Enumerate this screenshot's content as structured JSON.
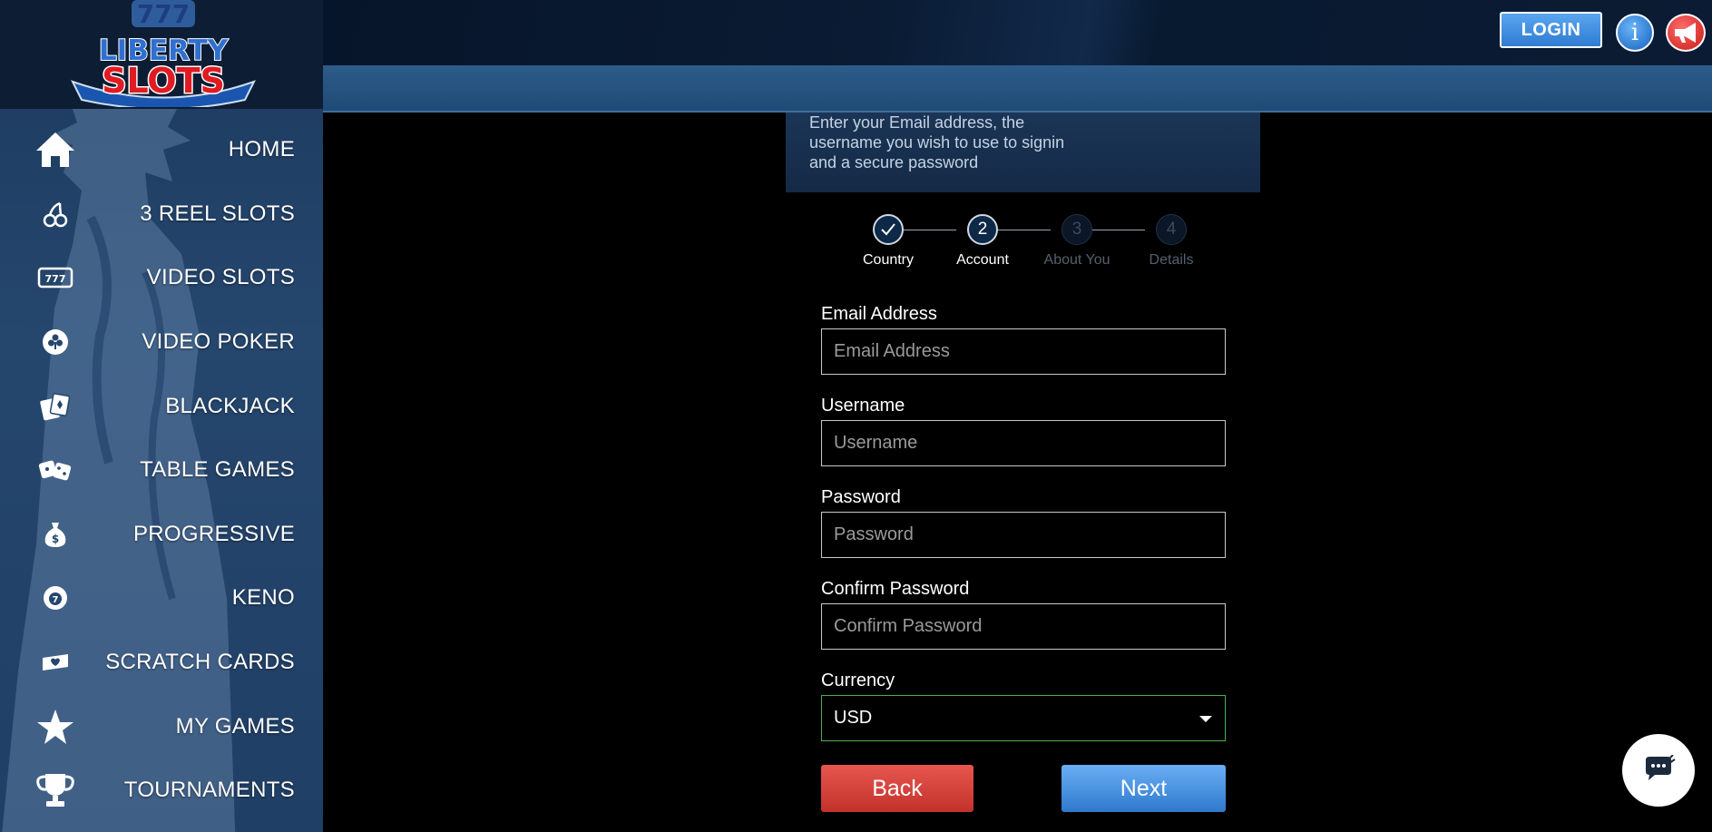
{
  "brand": {
    "logo_line1": "LIBERTY",
    "logo_line2": "SLOTS",
    "logo_sevens": "777"
  },
  "sidebar": {
    "items": [
      {
        "label": "HOME",
        "icon": "home-icon"
      },
      {
        "label": "3 REEL SLOTS",
        "icon": "cherries-icon"
      },
      {
        "label": "VIDEO SLOTS",
        "icon": "slot-machine-icon"
      },
      {
        "label": "VIDEO POKER",
        "icon": "club-chip-icon"
      },
      {
        "label": "BLACKJACK",
        "icon": "cards-icon"
      },
      {
        "label": "TABLE GAMES",
        "icon": "dice-icon"
      },
      {
        "label": "PROGRESSIVE",
        "icon": "money-bag-icon"
      },
      {
        "label": "KENO",
        "icon": "keno-ball-icon"
      },
      {
        "label": "SCRATCH CARDS",
        "icon": "scratch-card-icon"
      },
      {
        "label": "MY GAMES",
        "icon": "star-icon"
      },
      {
        "label": "TOURNAMENTS",
        "icon": "trophy-icon"
      }
    ]
  },
  "header": {
    "login_label": "LOGIN",
    "info_label": "i"
  },
  "instructions": {
    "line1": "Enter your Email address, the",
    "line2": "username you wish to use to signin",
    "line3": "and a secure password"
  },
  "stepper": {
    "steps": [
      {
        "number": "",
        "label": "Country",
        "state": "done"
      },
      {
        "number": "2",
        "label": "Account",
        "state": "active"
      },
      {
        "number": "3",
        "label": "About You",
        "state": "todo"
      },
      {
        "number": "4",
        "label": "Details",
        "state": "todo"
      }
    ]
  },
  "form": {
    "email": {
      "label": "Email Address",
      "placeholder": "Email Address",
      "value": ""
    },
    "username": {
      "label": "Username",
      "placeholder": "Username",
      "value": ""
    },
    "password": {
      "label": "Password",
      "placeholder": "Password",
      "value": ""
    },
    "confirm_password": {
      "label": "Confirm Password",
      "placeholder": "Confirm Password",
      "value": ""
    },
    "currency": {
      "label": "Currency",
      "selected": "USD"
    }
  },
  "actions": {
    "back_label": "Back",
    "next_label": "Next"
  },
  "colors": {
    "sidebar_bg": "#25466d",
    "login_blue": "#2f7bd1",
    "back_red": "#c3312b",
    "next_blue": "#2f78cc",
    "select_border": "#4caf50"
  }
}
